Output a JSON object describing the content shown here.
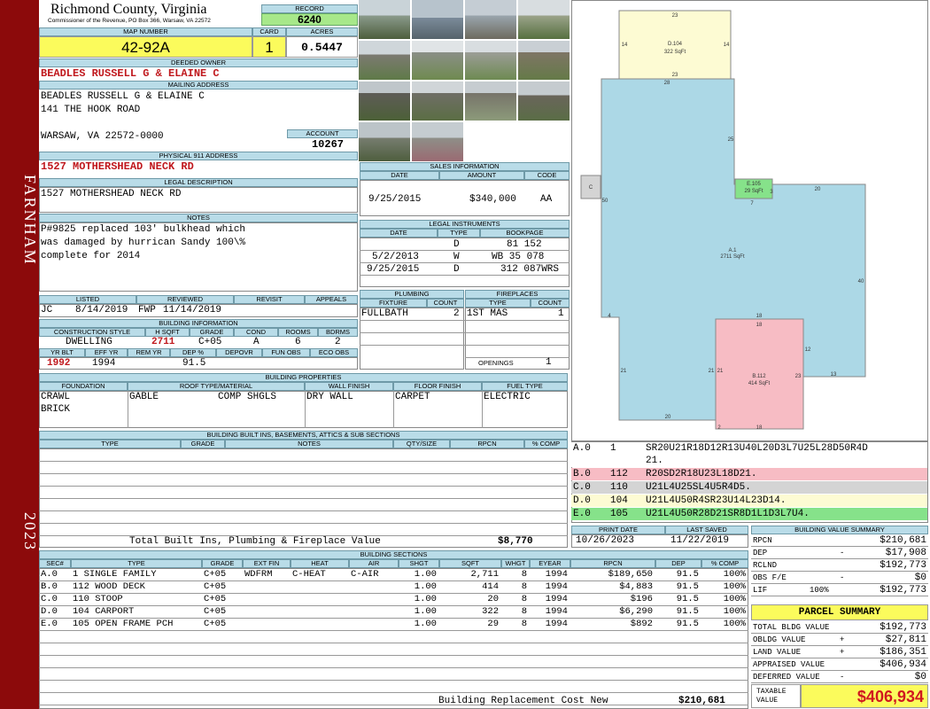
{
  "sidebar": {
    "location": "FARNHAM",
    "year": "2023"
  },
  "county": {
    "name": "Richmond County, Virginia",
    "address": "Commissioner of the Revenue, PO Box 366, Warsaw, VA 22572"
  },
  "record": {
    "label": "RECORD",
    "value": "6240"
  },
  "map_number": {
    "label": "MAP NUMBER",
    "value": "42-92A"
  },
  "card": {
    "label": "CARD",
    "value": "1"
  },
  "acres": {
    "label": "ACRES",
    "value": "0.5447"
  },
  "deeded_owner": {
    "label": "DEEDED OWNER",
    "value": "BEADLES RUSSELL G & ELAINE C"
  },
  "mailing": {
    "label": "MAILING ADDRESS",
    "line1": "BEADLES RUSSELL G & ELAINE C",
    "line2": "141 THE HOOK ROAD",
    "line3": "WARSAW, VA 22572-0000"
  },
  "account": {
    "label": "ACCOUNT",
    "value": "10267"
  },
  "physical": {
    "label": "PHYSICAL 911 ADDRESS",
    "value": "1527 MOTHERSHEAD NECK RD"
  },
  "legal": {
    "label": "LEGAL DESCRIPTION",
    "value": "1527 MOTHERSHEAD NECK RD"
  },
  "notes": {
    "label": "NOTES",
    "line1": "P#9825 replaced 103' bulkhead which",
    "line2": "was damaged by hurrican Sandy 100\\%",
    "line3": "complete for 2014"
  },
  "status": {
    "listed_label": "LISTED",
    "reviewed_label": "REVIEWED",
    "revisit_label": "REVISIT",
    "appeals_label": "APPEALS",
    "listed_by": "JC",
    "listed_date": "8/14/2019",
    "reviewed_by": "FWP",
    "reviewed_date": "11/14/2019"
  },
  "building_info": {
    "label": "BUILDING INFORMATION",
    "headers": [
      "CONSTRUCTION STYLE",
      "H SQFT",
      "GRADE",
      "COND",
      "ROOMS",
      "BDRMS"
    ],
    "values": [
      "DWELLING",
      "2711",
      "C+05",
      "A",
      "6",
      "2"
    ],
    "headers2": [
      "YR BLT",
      "EFF YR",
      "REM YR",
      "DEP %",
      "DEPOVR",
      "FUN OBS",
      "ECO OBS"
    ],
    "values2": [
      "1992",
      "1994",
      "",
      "91.5",
      "",
      "",
      ""
    ]
  },
  "sales": {
    "label": "SALES INFORMATION",
    "headers": [
      "DATE",
      "AMOUNT",
      "CODE"
    ],
    "date": "9/25/2015",
    "amount": "$340,000",
    "code": "AA"
  },
  "legal_instruments": {
    "label": "LEGAL INSTRUMENTS",
    "headers": [
      "DATE",
      "TYPE",
      "BOOKPAGE"
    ],
    "rows": [
      {
        "date": "",
        "type": "D",
        "book": "81 152"
      },
      {
        "date": "5/2/2013",
        "type": "W",
        "book": "WB 35 078"
      },
      {
        "date": "9/25/2015",
        "type": "D",
        "book": "312 087WRS"
      }
    ]
  },
  "plumbing": {
    "label": "PLUMBING",
    "headers": [
      "FIXTURE",
      "COUNT"
    ],
    "fixture": "FULLBATH",
    "count": "2"
  },
  "fireplaces": {
    "label": "FIREPLACES",
    "headers": [
      "TYPE",
      "COUNT"
    ],
    "type": "1ST MAS",
    "count": "1",
    "openings_label": "OPENINGS",
    "openings": "1"
  },
  "building_props": {
    "label": "BUILDING PROPERTIES",
    "headers": [
      "FOUNDATION",
      "ROOF TYPE/MATERIAL",
      "WALL FINISH",
      "FLOOR FINISH",
      "FUEL TYPE"
    ],
    "foundation1": "CRAWL",
    "foundation2": "BRICK",
    "roof_type": "GABLE",
    "roof_material": "COMP SHGLS",
    "wall": "DRY WALL",
    "floor": "CARPET",
    "fuel": "ELECTRIC"
  },
  "built_ins": {
    "label": "BUILDING BUILT INS, BASEMENTS, ATTICS & SUB SECTIONS",
    "headers": [
      "TYPE",
      "GRADE",
      "NOTES",
      "QTY/SIZE",
      "RPCN",
      "% COMP"
    ],
    "total_label": "Total Built Ins, Plumbing & Fireplace Value",
    "total": "$8,770"
  },
  "sketch": {
    "labels": {
      "D104": "D.104",
      "D104_area": "322 SqFt",
      "A1": "A.1",
      "A1_area": "2711 SqFt",
      "E105": "E.105",
      "E105_area": "29 SqFt",
      "B112": "B.112",
      "B112_area": "414 SqFt",
      "C": "C"
    },
    "dims": [
      "23",
      "14",
      "14",
      "23",
      "28",
      "25",
      "50",
      "3",
      "20",
      "7",
      "40",
      "4",
      "18",
      "18",
      "12",
      "21",
      "21",
      "21",
      "23",
      "13",
      "20",
      "2",
      "18"
    ]
  },
  "segments": [
    {
      "sec": "A.0",
      "code": "1",
      "path": "SR20U21R18D12R13U40L20D3L7U25L28D50R4D",
      "path2": "21.",
      "color": "#ffffff"
    },
    {
      "sec": "B.0",
      "code": "112",
      "path": "R20SD2R18U23L18D21.",
      "color": "#f7bcc4"
    },
    {
      "sec": "C.0",
      "code": "110",
      "path": "U21L4U25SL4U5R4D5.",
      "color": "#d4d4d4"
    },
    {
      "sec": "D.0",
      "code": "104",
      "path": "U21L4U50R4SR23U14L23D14.",
      "color": "#fdfbd3"
    },
    {
      "sec": "E.0",
      "code": "105",
      "path": "U21L4U50R28D21SR8D1L1D3L7U4.",
      "color": "#86e28a"
    }
  ],
  "dates": {
    "print_label": "PRINT DATE",
    "print": "10/26/2023",
    "saved_label": "LAST SAVED",
    "saved": "11/22/2019"
  },
  "bvs": {
    "label": "BUILDING VALUE SUMMARY",
    "rows": [
      {
        "l": "RPCN",
        "s": "",
        "v": "$210,681"
      },
      {
        "l": "DEP",
        "s": "-",
        "v": "$17,908"
      },
      {
        "l": "RCLND",
        "s": "",
        "v": "$192,773"
      },
      {
        "l": "OBS F/E",
        "s": "-",
        "v": "$0"
      },
      {
        "l": "LIF",
        "s": "100%",
        "v": "$192,773"
      }
    ]
  },
  "parcel": {
    "label": "PARCEL SUMMARY",
    "rows": [
      {
        "l": "TOTAL BLDG VALUE",
        "s": "",
        "v": "$192,773"
      },
      {
        "l": "OBLDG VALUE",
        "s": "+",
        "v": "$27,811"
      },
      {
        "l": "LAND VALUE",
        "s": "+",
        "v": "$186,351"
      },
      {
        "l": "APPRAISED VALUE",
        "s": "",
        "v": "$406,934"
      },
      {
        "l": "DEFERRED VALUE",
        "s": "-",
        "v": "$0"
      }
    ],
    "taxable_label1": "TAXABLE",
    "taxable_label2": "VALUE",
    "taxable": "$406,934"
  },
  "sections": {
    "label": "BUILDING SECTIONS",
    "headers": [
      "SEC#",
      "TYPE",
      "GRADE",
      "EXT FIN",
      "HEAT",
      "AIR",
      "SHGT",
      "SQFT",
      "WHGT",
      "EYEAR",
      "RPCN",
      "DEP",
      "% COMP"
    ],
    "rows": [
      [
        "A.0",
        "1 SINGLE FAMILY",
        "C+05",
        "WDFRM",
        "C-HEAT",
        "C-AIR",
        "1.00",
        "2,711",
        "8",
        "1994",
        "$189,650",
        "91.5",
        "100%"
      ],
      [
        "B.0",
        "112 WOOD DECK",
        "C+05",
        "",
        "",
        "",
        "1.00",
        "414",
        "8",
        "1994",
        "$4,883",
        "91.5",
        "100%"
      ],
      [
        "C.0",
        "110 STOOP",
        "C+05",
        "",
        "",
        "",
        "1.00",
        "20",
        "8",
        "1994",
        "$196",
        "91.5",
        "100%"
      ],
      [
        "D.0",
        "104 CARPORT",
        "C+05",
        "",
        "",
        "",
        "1.00",
        "322",
        "8",
        "1994",
        "$6,290",
        "91.5",
        "100%"
      ],
      [
        "E.0",
        "105 OPEN FRAME PCH",
        "C+05",
        "",
        "",
        "",
        "1.00",
        "29",
        "8",
        "1994",
        "$892",
        "91.5",
        "100%"
      ]
    ],
    "total_label": "Building Replacement Cost New",
    "total": "$210,681"
  }
}
